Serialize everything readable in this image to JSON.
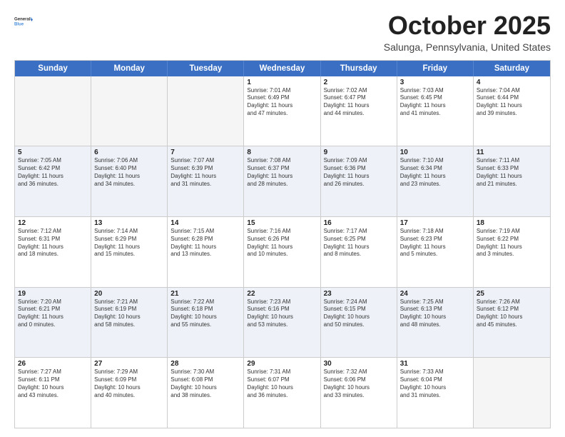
{
  "header": {
    "logo_line1": "General",
    "logo_line2": "Blue",
    "title": "October 2025",
    "location": "Salunga, Pennsylvania, United States"
  },
  "days_of_week": [
    "Sunday",
    "Monday",
    "Tuesday",
    "Wednesday",
    "Thursday",
    "Friday",
    "Saturday"
  ],
  "weeks": [
    [
      {
        "day": "",
        "text": "",
        "empty": true
      },
      {
        "day": "",
        "text": "",
        "empty": true
      },
      {
        "day": "",
        "text": "",
        "empty": true
      },
      {
        "day": "1",
        "text": "Sunrise: 7:01 AM\nSunset: 6:49 PM\nDaylight: 11 hours\nand 47 minutes."
      },
      {
        "day": "2",
        "text": "Sunrise: 7:02 AM\nSunset: 6:47 PM\nDaylight: 11 hours\nand 44 minutes."
      },
      {
        "day": "3",
        "text": "Sunrise: 7:03 AM\nSunset: 6:45 PM\nDaylight: 11 hours\nand 41 minutes."
      },
      {
        "day": "4",
        "text": "Sunrise: 7:04 AM\nSunset: 6:44 PM\nDaylight: 11 hours\nand 39 minutes."
      }
    ],
    [
      {
        "day": "5",
        "text": "Sunrise: 7:05 AM\nSunset: 6:42 PM\nDaylight: 11 hours\nand 36 minutes."
      },
      {
        "day": "6",
        "text": "Sunrise: 7:06 AM\nSunset: 6:40 PM\nDaylight: 11 hours\nand 34 minutes."
      },
      {
        "day": "7",
        "text": "Sunrise: 7:07 AM\nSunset: 6:39 PM\nDaylight: 11 hours\nand 31 minutes."
      },
      {
        "day": "8",
        "text": "Sunrise: 7:08 AM\nSunset: 6:37 PM\nDaylight: 11 hours\nand 28 minutes."
      },
      {
        "day": "9",
        "text": "Sunrise: 7:09 AM\nSunset: 6:36 PM\nDaylight: 11 hours\nand 26 minutes."
      },
      {
        "day": "10",
        "text": "Sunrise: 7:10 AM\nSunset: 6:34 PM\nDaylight: 11 hours\nand 23 minutes."
      },
      {
        "day": "11",
        "text": "Sunrise: 7:11 AM\nSunset: 6:33 PM\nDaylight: 11 hours\nand 21 minutes."
      }
    ],
    [
      {
        "day": "12",
        "text": "Sunrise: 7:12 AM\nSunset: 6:31 PM\nDaylight: 11 hours\nand 18 minutes."
      },
      {
        "day": "13",
        "text": "Sunrise: 7:14 AM\nSunset: 6:29 PM\nDaylight: 11 hours\nand 15 minutes."
      },
      {
        "day": "14",
        "text": "Sunrise: 7:15 AM\nSunset: 6:28 PM\nDaylight: 11 hours\nand 13 minutes."
      },
      {
        "day": "15",
        "text": "Sunrise: 7:16 AM\nSunset: 6:26 PM\nDaylight: 11 hours\nand 10 minutes."
      },
      {
        "day": "16",
        "text": "Sunrise: 7:17 AM\nSunset: 6:25 PM\nDaylight: 11 hours\nand 8 minutes."
      },
      {
        "day": "17",
        "text": "Sunrise: 7:18 AM\nSunset: 6:23 PM\nDaylight: 11 hours\nand 5 minutes."
      },
      {
        "day": "18",
        "text": "Sunrise: 7:19 AM\nSunset: 6:22 PM\nDaylight: 11 hours\nand 3 minutes."
      }
    ],
    [
      {
        "day": "19",
        "text": "Sunrise: 7:20 AM\nSunset: 6:21 PM\nDaylight: 11 hours\nand 0 minutes."
      },
      {
        "day": "20",
        "text": "Sunrise: 7:21 AM\nSunset: 6:19 PM\nDaylight: 10 hours\nand 58 minutes."
      },
      {
        "day": "21",
        "text": "Sunrise: 7:22 AM\nSunset: 6:18 PM\nDaylight: 10 hours\nand 55 minutes."
      },
      {
        "day": "22",
        "text": "Sunrise: 7:23 AM\nSunset: 6:16 PM\nDaylight: 10 hours\nand 53 minutes."
      },
      {
        "day": "23",
        "text": "Sunrise: 7:24 AM\nSunset: 6:15 PM\nDaylight: 10 hours\nand 50 minutes."
      },
      {
        "day": "24",
        "text": "Sunrise: 7:25 AM\nSunset: 6:13 PM\nDaylight: 10 hours\nand 48 minutes."
      },
      {
        "day": "25",
        "text": "Sunrise: 7:26 AM\nSunset: 6:12 PM\nDaylight: 10 hours\nand 45 minutes."
      }
    ],
    [
      {
        "day": "26",
        "text": "Sunrise: 7:27 AM\nSunset: 6:11 PM\nDaylight: 10 hours\nand 43 minutes."
      },
      {
        "day": "27",
        "text": "Sunrise: 7:29 AM\nSunset: 6:09 PM\nDaylight: 10 hours\nand 40 minutes."
      },
      {
        "day": "28",
        "text": "Sunrise: 7:30 AM\nSunset: 6:08 PM\nDaylight: 10 hours\nand 38 minutes."
      },
      {
        "day": "29",
        "text": "Sunrise: 7:31 AM\nSunset: 6:07 PM\nDaylight: 10 hours\nand 36 minutes."
      },
      {
        "day": "30",
        "text": "Sunrise: 7:32 AM\nSunset: 6:06 PM\nDaylight: 10 hours\nand 33 minutes."
      },
      {
        "day": "31",
        "text": "Sunrise: 7:33 AM\nSunset: 6:04 PM\nDaylight: 10 hours\nand 31 minutes."
      },
      {
        "day": "",
        "text": "",
        "empty": true
      }
    ]
  ]
}
